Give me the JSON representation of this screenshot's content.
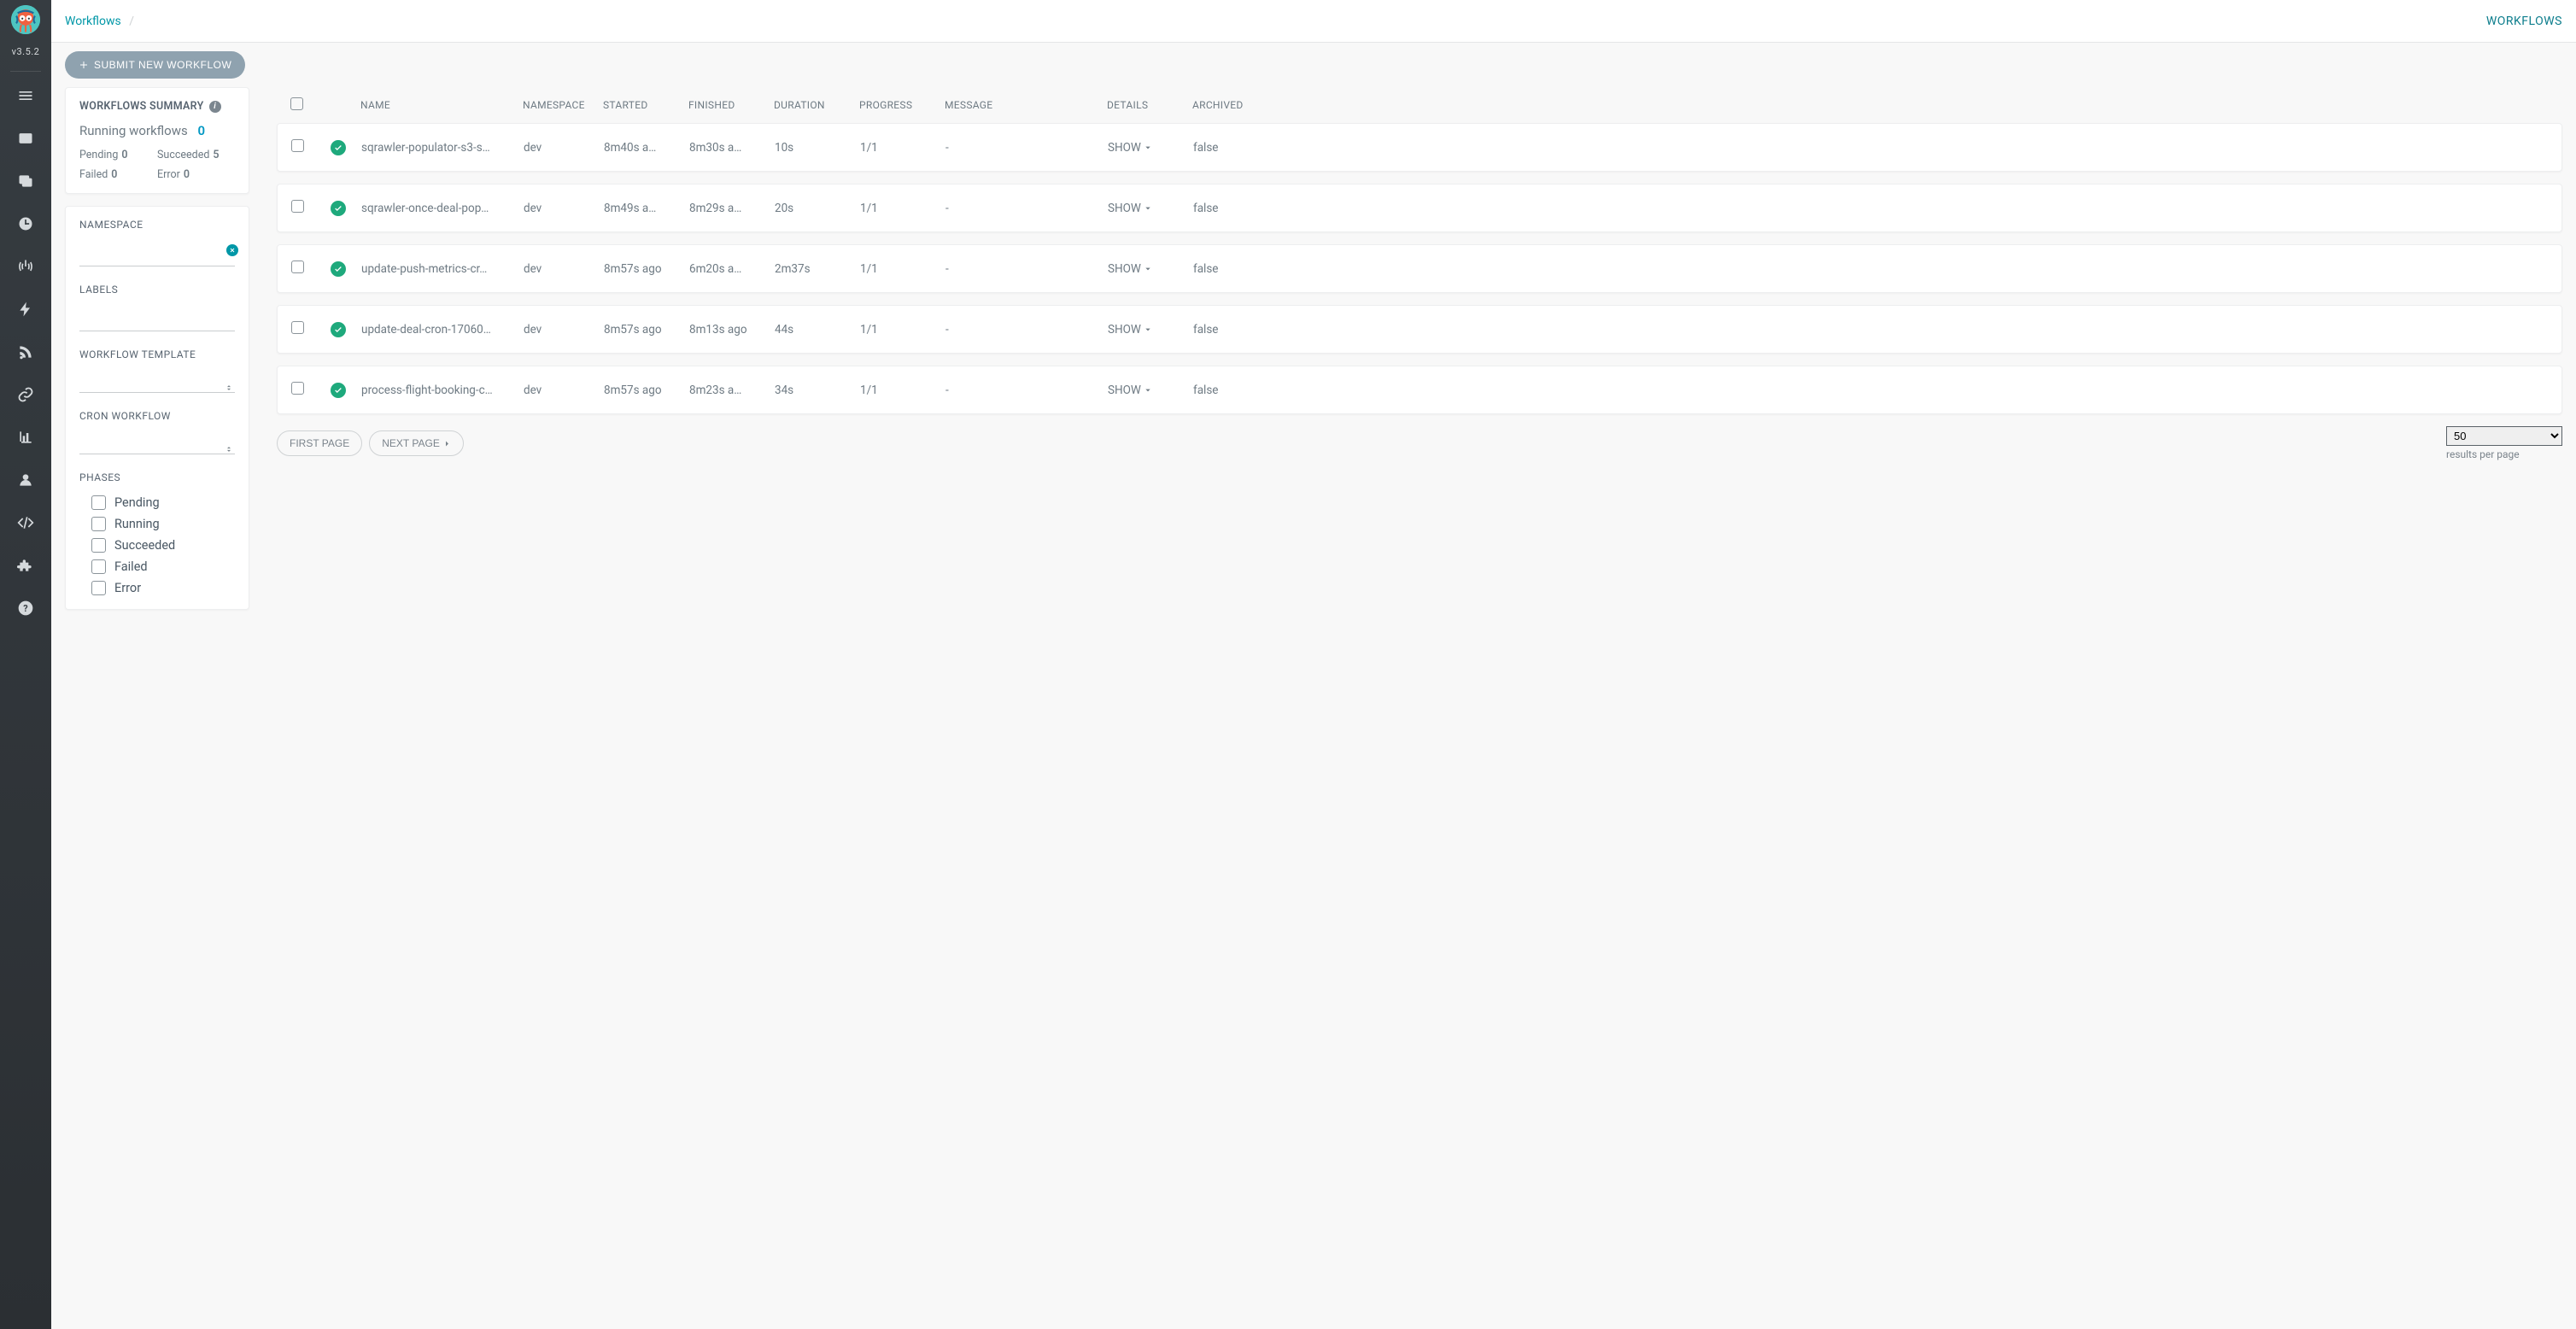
{
  "version": "v3.5.2",
  "breadcrumb": {
    "root": "Workflows"
  },
  "page_title": "WORKFLOWS",
  "submit_button": "SUBMIT NEW WORKFLOW",
  "summary": {
    "title": "WORKFLOWS SUMMARY",
    "running_label": "Running workflows",
    "running_count": "0",
    "pending_label": "Pending",
    "pending_val": "0",
    "succeeded_label": "Succeeded",
    "succeeded_val": "5",
    "failed_label": "Failed",
    "failed_val": "0",
    "error_label": "Error",
    "error_val": "0"
  },
  "filters": {
    "namespace_label": "NAMESPACE",
    "namespace_value": "",
    "labels_label": "LABELS",
    "labels_value": "",
    "wft_label": "WORKFLOW TEMPLATE",
    "cron_label": "CRON WORKFLOW",
    "phases_label": "PHASES",
    "phases": [
      "Pending",
      "Running",
      "Succeeded",
      "Failed",
      "Error"
    ]
  },
  "headers": {
    "name": "NAME",
    "namespace": "NAMESPACE",
    "started": "STARTED",
    "finished": "FINISHED",
    "duration": "DURATION",
    "progress": "PROGRESS",
    "message": "MESSAGE",
    "details": "DETAILS",
    "archived": "ARCHIVED"
  },
  "rows": [
    {
      "name": "sqrawler-populator-s3-s…",
      "namespace": "dev",
      "started": "8m40s a…",
      "finished": "8m30s a…",
      "duration": "10s",
      "progress": "1/1",
      "message": "-",
      "details": "SHOW",
      "archived": "false"
    },
    {
      "name": "sqrawler-once-deal-pop…",
      "namespace": "dev",
      "started": "8m49s a…",
      "finished": "8m29s a…",
      "duration": "20s",
      "progress": "1/1",
      "message": "-",
      "details": "SHOW",
      "archived": "false"
    },
    {
      "name": "update-push-metrics-cr…",
      "namespace": "dev",
      "started": "8m57s ago",
      "finished": "6m20s a…",
      "duration": "2m37s",
      "progress": "1/1",
      "message": "-",
      "details": "SHOW",
      "archived": "false"
    },
    {
      "name": "update-deal-cron-17060…",
      "namespace": "dev",
      "started": "8m57s ago",
      "finished": "8m13s ago",
      "duration": "44s",
      "progress": "1/1",
      "message": "-",
      "details": "SHOW",
      "archived": "false"
    },
    {
      "name": "process-flight-booking-c…",
      "namespace": "dev",
      "started": "8m57s ago",
      "finished": "8m23s a…",
      "duration": "34s",
      "progress": "1/1",
      "message": "-",
      "details": "SHOW",
      "archived": "false"
    }
  ],
  "pager": {
    "first": "FIRST PAGE",
    "next": "NEXT PAGE",
    "page_size": "50",
    "page_hint": "results per page"
  }
}
